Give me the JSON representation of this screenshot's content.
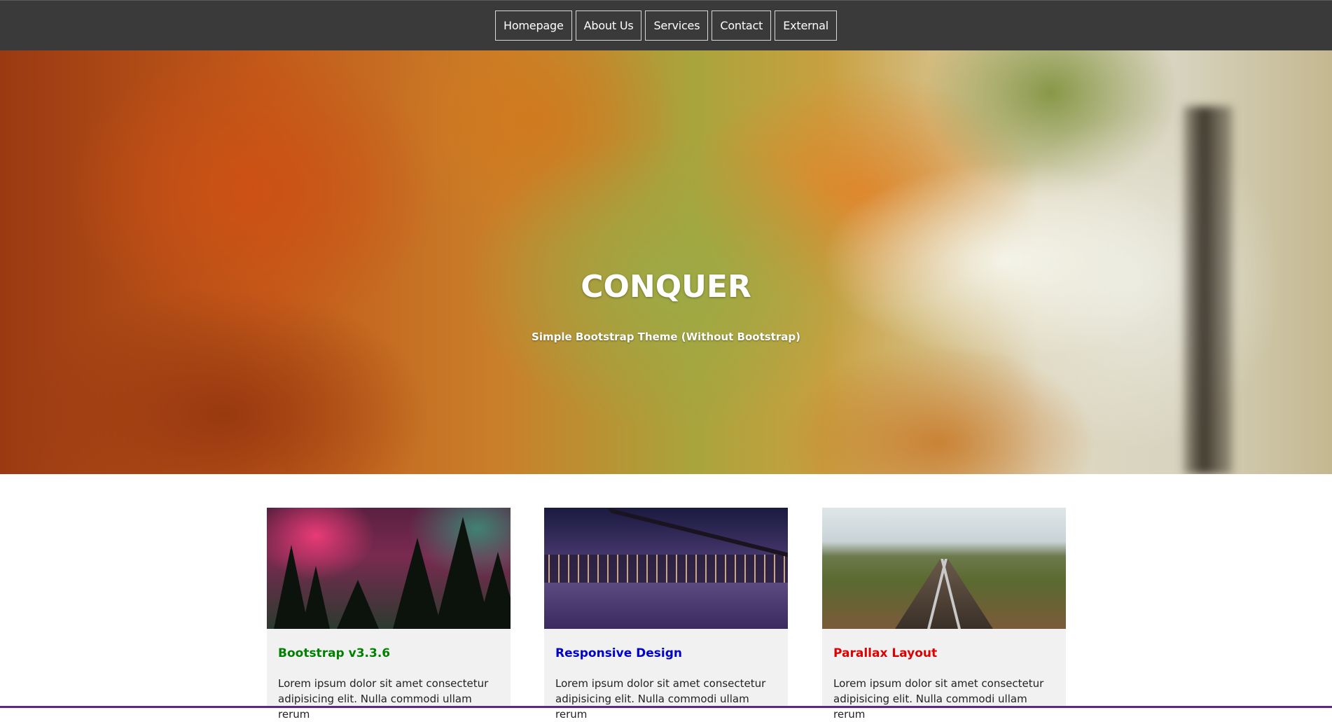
{
  "nav": {
    "items": [
      {
        "label": "Homepage"
      },
      {
        "label": "About Us"
      },
      {
        "label": "Services"
      },
      {
        "label": "Contact"
      },
      {
        "label": "External"
      }
    ]
  },
  "hero": {
    "title": "CONQUER",
    "subtitle": "Simple Bootstrap Theme (Without Bootstrap)"
  },
  "cards": [
    {
      "title": "Bootstrap v3.3.6",
      "title_color": "#008000",
      "text": "Lorem ipsum dolor sit amet consectetur adipisicing elit. Nulla commodi ullam rerum"
    },
    {
      "title": "Responsive Design",
      "title_color": "#0000cc",
      "text": "Lorem ipsum dolor sit amet consectetur adipisicing elit. Nulla commodi ullam rerum"
    },
    {
      "title": "Parallax Layout",
      "title_color": "#e00000",
      "text": "Lorem ipsum dolor sit amet consectetur adipisicing elit. Nulla commodi ullam rerum"
    }
  ],
  "colors": {
    "nav_bg": "#3a3a3a",
    "card_bg": "#f1f1f1"
  }
}
